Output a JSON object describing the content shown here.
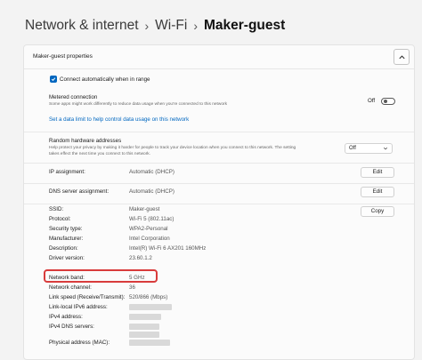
{
  "breadcrumb": {
    "items": [
      "Network & internet",
      "Wi-Fi",
      "Maker-guest"
    ],
    "separator": "›"
  },
  "card": {
    "title": "Maker-guest properties",
    "collapse_icon": "chevron-up-icon"
  },
  "connect_auto": {
    "label": "Connect automatically when in range",
    "checked": true
  },
  "metered": {
    "title": "Metered connection",
    "description": "Some apps might work differently to reduce data usage when you're connected to this network",
    "state_label": "Off",
    "on": false
  },
  "data_limit_link": "Set a data limit to help control data usage on this network",
  "random_hw": {
    "title": "Random hardware addresses",
    "description_line1": "Help protect your privacy by making it harder for people to track your device location when you connect to this network. The setting",
    "description_line2": "takes effect the next time you connect to this network.",
    "selected": "Off"
  },
  "ip_assignment": {
    "label": "IP assignment:",
    "value": "Automatic (DHCP)",
    "button": "Edit"
  },
  "dns_assignment": {
    "label": "DNS server assignment:",
    "value": "Automatic (DHCP)",
    "button": "Edit"
  },
  "properties": {
    "copy_button": "Copy",
    "items": [
      {
        "label": "SSID:",
        "value": "Maker-guest"
      },
      {
        "label": "Protocol:",
        "value": "Wi-Fi 5 (802.11ac)"
      },
      {
        "label": "Security type:",
        "value": "WPA2-Personal"
      },
      {
        "label": "Manufacturer:",
        "value": "Intel Corporation"
      },
      {
        "label": "Description:",
        "value": "Intel(R) Wi-Fi 6 AX201 160MHz"
      },
      {
        "label": "Driver version:",
        "value": "23.60.1.2"
      },
      {
        "label": "Network band:",
        "value": "5 GHz"
      },
      {
        "label": "Network channel:",
        "value": "36"
      },
      {
        "label": "Link speed (Receive/Transmit):",
        "value": "520/866 (Mbps)"
      },
      {
        "label": "Link-local IPv6 address:",
        "value": ""
      },
      {
        "label": "IPv4 address:",
        "value": ""
      },
      {
        "label": "IPv4 DNS servers:",
        "value": ""
      },
      {
        "label": "Physical address (MAC):",
        "value": ""
      }
    ]
  },
  "colors": {
    "accent": "#0067c0",
    "highlight": "#d83b3b"
  }
}
